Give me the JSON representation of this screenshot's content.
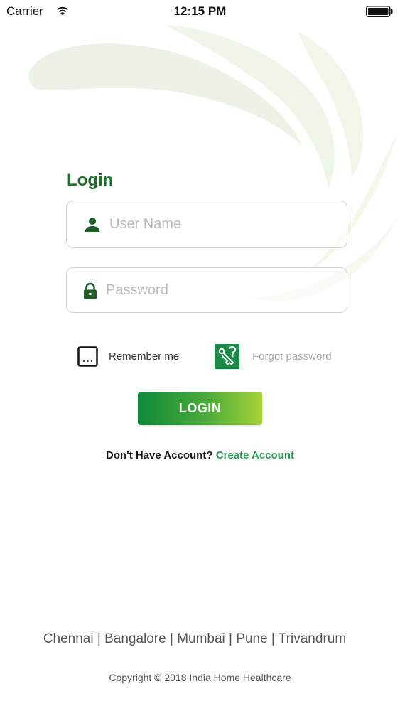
{
  "status_bar": {
    "carrier": "Carrier",
    "time": "12:15 PM",
    "wifi_icon": "wifi-icon",
    "battery_icon": "battery-full-icon"
  },
  "login": {
    "title": "Login",
    "username": {
      "placeholder": "User Name",
      "value": "",
      "icon": "person-icon"
    },
    "password": {
      "placeholder": "Password",
      "value": "",
      "icon": "lock-icon"
    },
    "remember_me": {
      "label": "Remember me",
      "checked": false
    },
    "forgot_password": {
      "label": "Forgot password",
      "icon": "forgot-password-icon"
    },
    "login_button": "LOGIN",
    "no_account_text": "Don't Have Account?",
    "create_account_link": "Create Account"
  },
  "footer": {
    "cities": "Chennai | Bangalore | Mumbai | Pune | Trivandrum",
    "copyright": "Copyright © 2018 India Home Healthcare"
  },
  "colors": {
    "accent_green": "#1f6f2a",
    "link_green": "#2a9a58",
    "button_gradient_start": "#0f8a3a",
    "button_gradient_end": "#a6d138",
    "placeholder_gray": "#b9b9c1"
  }
}
